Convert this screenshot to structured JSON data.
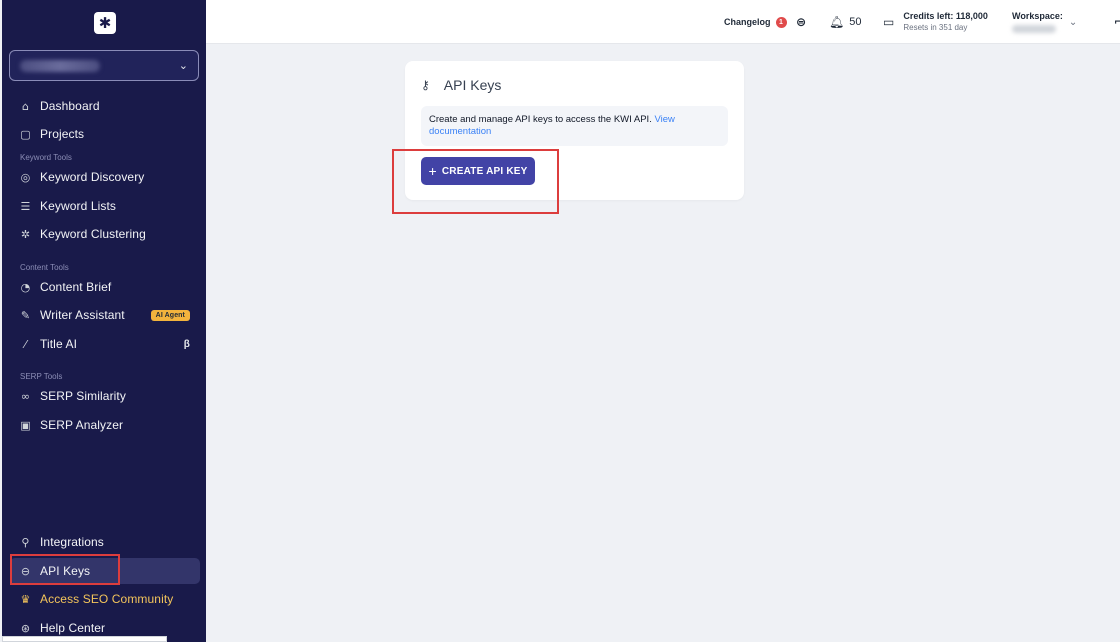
{
  "sidebar": {
    "logo_glyph": "✱",
    "items": [
      {
        "label": "Dashboard",
        "icon": "home-icon",
        "glyph": "⌂"
      },
      {
        "label": "Projects",
        "icon": "document-icon",
        "glyph": "▢"
      },
      {
        "label": "Keyword Discovery",
        "icon": "compass-icon",
        "glyph": "◎"
      },
      {
        "label": "Keyword Lists",
        "icon": "list-icon",
        "glyph": "☰"
      },
      {
        "label": "Keyword Clustering",
        "icon": "cluster-icon",
        "glyph": "✲"
      },
      {
        "label": "Content Brief",
        "icon": "brief-icon",
        "glyph": "◔"
      },
      {
        "label": "Writer Assistant",
        "icon": "edit-icon",
        "glyph": "✎",
        "badge": "AI Agent"
      },
      {
        "label": "Title AI",
        "icon": "magic-wand-icon",
        "glyph": "⁄",
        "badge": "β"
      },
      {
        "label": "SERP Similarity",
        "icon": "link-icon",
        "glyph": "∞"
      },
      {
        "label": "SERP Analyzer",
        "icon": "monitor-icon",
        "glyph": "▣"
      },
      {
        "label": "Integrations",
        "icon": "plug-icon",
        "glyph": "⚲"
      },
      {
        "label": "API Keys",
        "icon": "api-icon",
        "glyph": "⊖"
      },
      {
        "label": "Access SEO Community",
        "icon": "crown-icon",
        "glyph": "♛"
      },
      {
        "label": "Help Center",
        "icon": "help-icon",
        "glyph": "⊛"
      }
    ],
    "sections": [
      "Keyword Tools",
      "Content Tools",
      "SERP Tools"
    ]
  },
  "topbar": {
    "changelog": "Changelog",
    "changelog_count": "1",
    "notifications": "50",
    "credits": "Credits left: 118,000",
    "resets": "Resets in 351 day",
    "workspace": "Workspace:"
  },
  "card": {
    "title": "API Keys",
    "description": "Create and manage API keys to access the KWI API.",
    "link": "View documentation",
    "button": "CREATE API KEY"
  },
  "colors": {
    "sidebar_bg": "#191a4a",
    "primary": "#4243a6",
    "highlight_box": "#dc3d3d"
  }
}
